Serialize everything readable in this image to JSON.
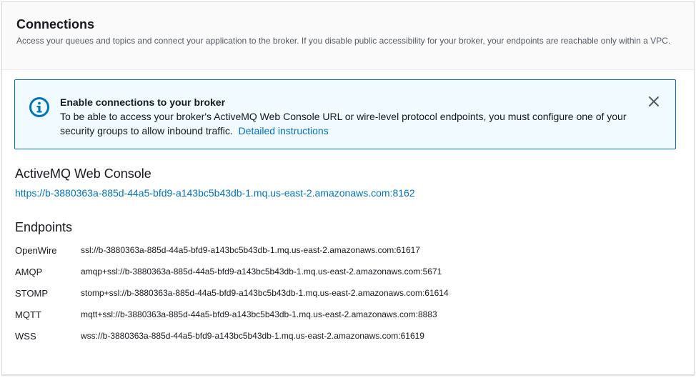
{
  "header": {
    "title": "Connections",
    "description": "Access your queues and topics and connect your application to the broker. If you disable public accessibility for your broker, your endpoints are reachable only within a VPC."
  },
  "alert": {
    "icon": "info-icon",
    "title": "Enable connections to your broker",
    "message": "To be able to access your broker's ActiveMQ Web Console URL or wire-level protocol endpoints, you must configure one of your security groups to allow inbound traffic.",
    "link_label": "Detailed instructions",
    "close_icon": "close-icon"
  },
  "web_console": {
    "heading": "ActiveMQ Web Console",
    "url": "https://b-3880363a-885d-44a5-bfd9-a143bc5b43db-1.mq.us-east-2.amazonaws.com:8162"
  },
  "endpoints": {
    "heading": "Endpoints",
    "items": [
      {
        "name": "OpenWire",
        "url": "ssl://b-3880363a-885d-44a5-bfd9-a143bc5b43db-1.mq.us-east-2.amazonaws.com:61617"
      },
      {
        "name": "AMQP",
        "url": "amqp+ssl://b-3880363a-885d-44a5-bfd9-a143bc5b43db-1.mq.us-east-2.amazonaws.com:5671"
      },
      {
        "name": "STOMP",
        "url": "stomp+ssl://b-3880363a-885d-44a5-bfd9-a143bc5b43db-1.mq.us-east-2.amazonaws.com:61614"
      },
      {
        "name": "MQTT",
        "url": "mqtt+ssl://b-3880363a-885d-44a5-bfd9-a143bc5b43db-1.mq.us-east-2.amazonaws.com:8883"
      },
      {
        "name": "WSS",
        "url": "wss://b-3880363a-885d-44a5-bfd9-a143bc5b43db-1.mq.us-east-2.amazonaws.com:61619"
      }
    ]
  },
  "colors": {
    "link": "#0073bb",
    "alert_border": "#0073bb",
    "alert_background": "#f1faff",
    "header_background": "#fafafa"
  }
}
